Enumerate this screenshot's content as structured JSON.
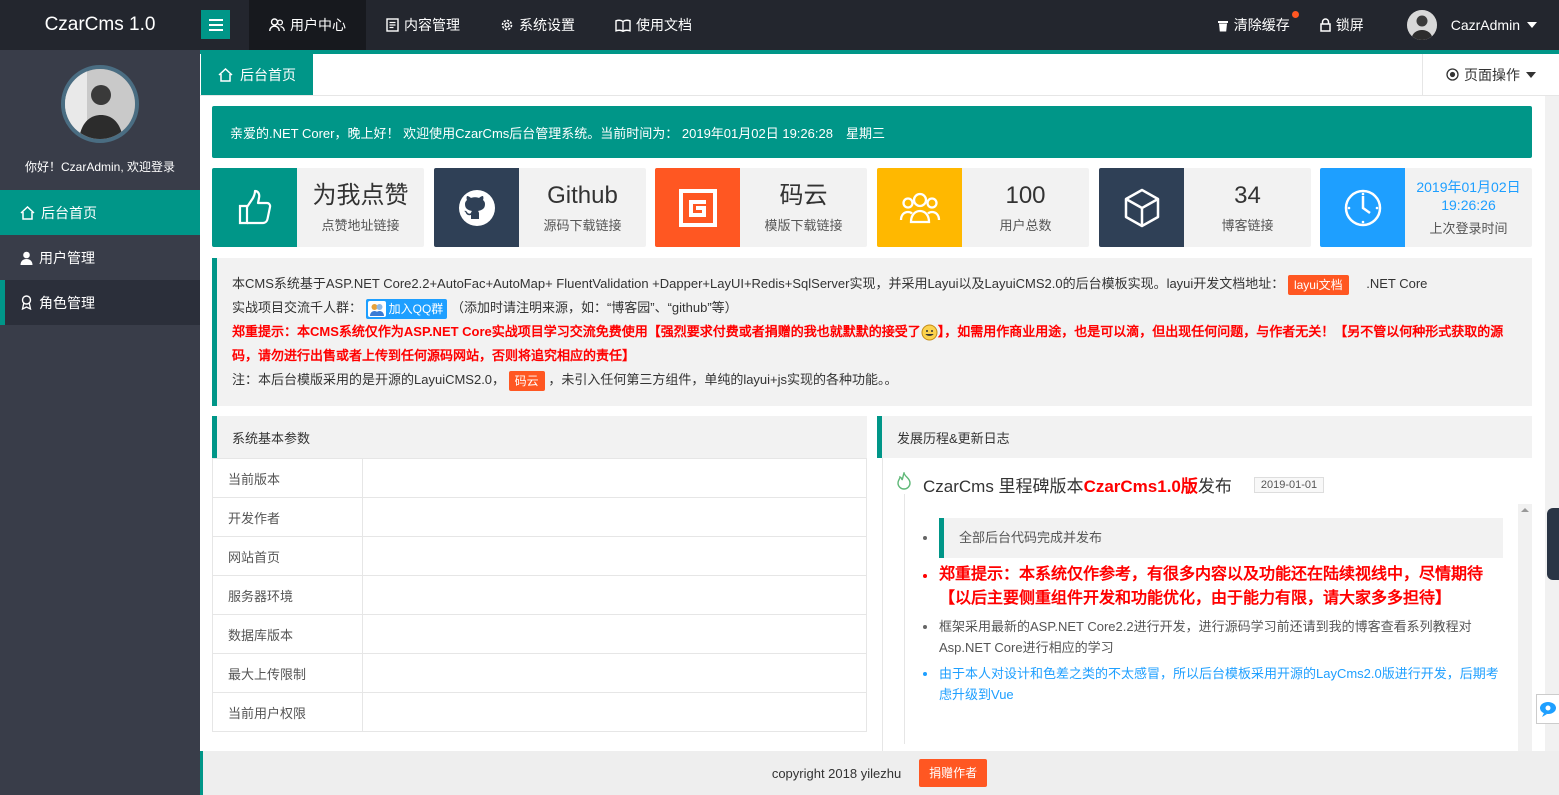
{
  "app": {
    "title": "CzarCms 1.0"
  },
  "topnav": [
    {
      "label": "用户中心",
      "icon": "users-icon"
    },
    {
      "label": "内容管理",
      "icon": "document-icon"
    },
    {
      "label": "系统设置",
      "icon": "gear-icon"
    },
    {
      "label": "使用文档",
      "icon": "book-icon"
    }
  ],
  "topright": {
    "clear_cache": "清除缓存",
    "lock": "锁屏",
    "user": "CazrAdmin"
  },
  "sidebar": {
    "greeting": "你好！CzarAdmin, 欢迎登录",
    "items": [
      {
        "label": "后台首页",
        "icon": "home-icon"
      },
      {
        "label": "用户管理",
        "icon": "user-icon"
      },
      {
        "label": "角色管理",
        "icon": "award-icon"
      }
    ]
  },
  "tabs": {
    "home": "后台首页",
    "page_ops": "页面操作"
  },
  "welcome": "亲爱的.NET Corer，晚上好！ 欢迎使用CzarCms后台管理系统。当前时间为： 2019年01月02日 19:26:28　星期三",
  "cards": [
    {
      "value": "为我点赞",
      "label": "点赞地址链接",
      "color": "#009688",
      "icon": "thumbs-up-icon"
    },
    {
      "value": "Github",
      "label": "源码下载链接",
      "color": "#2f4056",
      "icon": "github-icon"
    },
    {
      "value": "码云",
      "label": "模版下载链接",
      "color": "#ff5722",
      "icon": "gitee-icon"
    },
    {
      "value": "100",
      "label": "用户总数",
      "color": "#ffb800",
      "icon": "group-icon"
    },
    {
      "value": "34",
      "label": "博客链接",
      "color": "#2f4056",
      "icon": "cube-icon"
    },
    {
      "value_line1": "2019年01月02日",
      "value_line2": "19:26:26",
      "label": "上次登录时间",
      "color": "#1e9fff",
      "icon": "clock-icon"
    }
  ],
  "intro": {
    "line1": "本CMS系统基于ASP.NET Core2.2+AutoFac+AutoMap+ FluentValidation +Dapper+LayUI+Redis+SqlServer实现，并采用Layui以及LayuiCMS2.0的后台模板实现。layui开发文档地址：",
    "layui_doc": "layui文档",
    "line1b": ".NET Core",
    "line2": "实战项目交流千人群：",
    "qq_btn": "加入QQ群",
    "line2b": "（添加时请注明来源，如：“博客园”、“github”等）",
    "warn_a": "郑重提示：本CMS系统仅作为ASP.NET Core实战项目学习交流免费使用【强烈要求付费或者捐赠的我也就默默的接受了",
    "warn_b": "】，如需用作商业用途，也是可以滴，但出现任何问题，与作者无关！【另不管以何种形式获取的源码，请勿进行出售或者上传到任何源码网站，否则将追究相应的责任】",
    "note_a": "注：本后台模版采用的是开源的LayuiCMS2.0，",
    "gitee_btn": "码云",
    "note_b": "，未引入任何第三方组件，单纯的layui+js实现的各种功能。。"
  },
  "params": {
    "title": "系统基本参数",
    "rows": [
      "当前版本",
      "开发作者",
      "网站首页",
      "服务器环境",
      "数据库版本",
      "最大上传限制",
      "当前用户权限"
    ]
  },
  "changelog": {
    "title": "发展历程&更新日志",
    "entry_title_a": "CzarCms 里程碑版本",
    "entry_title_hl": "CzarCms1.0版",
    "entry_title_b": "发布",
    "date": "2019-01-01",
    "quote": "全部后台代码完成并发布",
    "red": "郑重提示：本系统仅作参考，有很多内容以及功能还在陆续视线中，尽情期待【以后主要侧重组件开发和功能优化，由于能力有限，请大家多多担待】",
    "gray": "框架采用最新的ASP.NET Core2.2进行开发，进行源码学习前还请到我的博客查看系列教程对Asp.NET Core进行相应的学习",
    "blue": "由于本人对设计和色差之类的不太感冒，所以后台模板采用开源的LayCms2.0版进行开发，后期考虑升级到Vue"
  },
  "footer": {
    "copyright": "copyright 2018 yilezhu",
    "donate": "捐赠作者"
  },
  "colors": {
    "accent": "#009688",
    "header": "#23262e",
    "sidebar": "#393d49",
    "danger": "#ff5722",
    "info": "#1e9fff"
  }
}
